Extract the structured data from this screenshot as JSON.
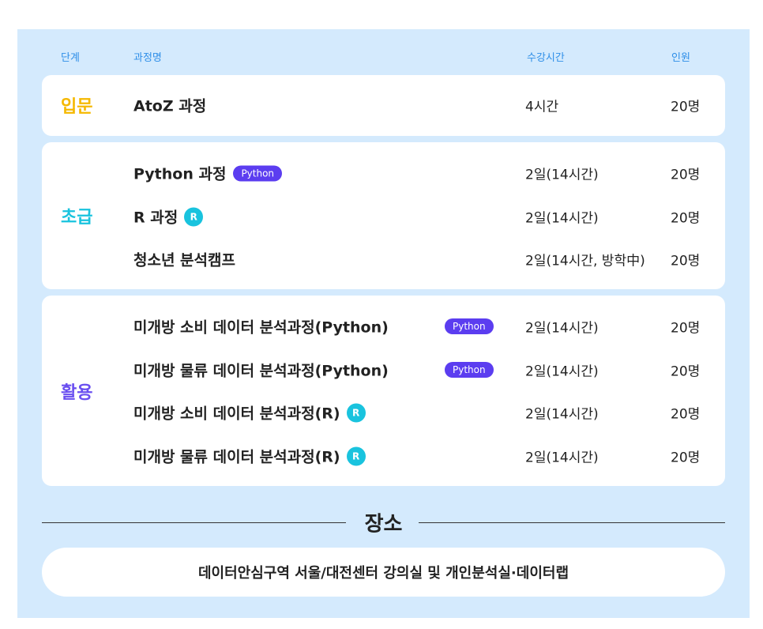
{
  "header": {
    "stage": "단계",
    "course": "과정명",
    "hours": "수강시간",
    "people": "인원"
  },
  "groups": [
    {
      "stage": "입문",
      "color": "#f5b800",
      "rows": [
        {
          "name": "AtoZ 과정",
          "hours": "4시간",
          "people": "20명"
        }
      ]
    },
    {
      "stage": "초급",
      "color": "#19c3de",
      "rows": [
        {
          "name": "Python 과정",
          "badge": "Python",
          "hours": "2일(14시간)",
          "people": "20명"
        },
        {
          "name": "R 과정",
          "badge": "R",
          "hours": "2일(14시간)",
          "people": "20명"
        },
        {
          "name": "청소년 분석캠프",
          "hours": "2일(14시간, 방학中)",
          "people": "20명"
        }
      ]
    },
    {
      "stage": "활용",
      "color": "#6a4ff0",
      "rows": [
        {
          "name": "미개방 소비 데이터 분석과정(Python)",
          "badge": "Python",
          "hours": "2일(14시간)",
          "people": "20명"
        },
        {
          "name": "미개방 물류 데이터 분석과정(Python)",
          "badge": "Python",
          "hours": "2일(14시간)",
          "people": "20명"
        },
        {
          "name": "미개방 소비 데이터 분석과정(R)",
          "badge": "R",
          "hours": "2일(14시간)",
          "people": "20명"
        },
        {
          "name": "미개방 물류 데이터 분석과정(R)",
          "badge": "R",
          "hours": "2일(14시간)",
          "people": "20명"
        }
      ]
    }
  ],
  "place": {
    "title": "장소",
    "text": "데이터안심구역 서울/대전센터 강의실 및 개인분석실·데이터랩"
  },
  "colors": {
    "background": "#d4eafd",
    "header_text": "#2f8fe8",
    "python_badge": "#5b3df0",
    "r_badge": "#19c3de"
  }
}
